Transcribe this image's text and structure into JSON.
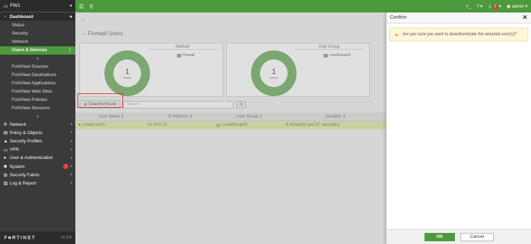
{
  "sidebar": {
    "device": "FW1",
    "dashboard_label": "Dashboard",
    "dashboard_items": [
      "Status",
      "Security",
      "Network",
      "Users & Devices"
    ],
    "fortiview_items": [
      "FortiView Sources",
      "FortiView Destinations",
      "FortiView Applications",
      "FortiView Web Sites",
      "FortiView Policies",
      "FortiView Sessions"
    ],
    "menu_items": [
      {
        "label": "Network",
        "icon": "network-icon"
      },
      {
        "label": "Policy & Objects",
        "icon": "policy-icon"
      },
      {
        "label": "Security Profiles",
        "icon": "lock-icon"
      },
      {
        "label": "VPN",
        "icon": "monitor-icon"
      },
      {
        "label": "User & Authentication",
        "icon": "user-icon"
      },
      {
        "label": "System",
        "icon": "gear-icon",
        "badge": "1"
      },
      {
        "label": "Security Fabric",
        "icon": "fabric-icon"
      },
      {
        "label": "Log & Report",
        "icon": "chart-icon"
      }
    ],
    "logo": "F■RTINET",
    "version": "v7.2.0"
  },
  "topbar": {
    "cli_label": ">_",
    "help_label": "?",
    "notif_count": "3",
    "user": "admin"
  },
  "main": {
    "page_title": "Firewall Users",
    "widget1": {
      "title": "Method",
      "count": "1",
      "unit": "Users",
      "legend": "Firewall"
    },
    "widget2": {
      "title": "User Group",
      "count": "1",
      "unit": "Users",
      "legend": "LocalGroup01"
    },
    "deauth_label": "Deauthenticate",
    "search_placeholder": "Search",
    "columns": [
      "User Name ⇕",
      "IP Address ⇕",
      "User Group ⇕",
      "Duration ⇕"
    ],
    "row": {
      "user": "LocalUser01",
      "ip": "10.10.0.13",
      "group": "LocalGroup01",
      "duration": "4 minute(s) and 37 second(s)"
    }
  },
  "dialog": {
    "title": "Confirm",
    "message": "Are you sure you want to deauthenticate the selected user(s)?",
    "ok_label": "OK",
    "cancel_label": "Cancel"
  },
  "colors": {
    "accent": "#4d9a3d",
    "highlight": "#dd3333"
  }
}
